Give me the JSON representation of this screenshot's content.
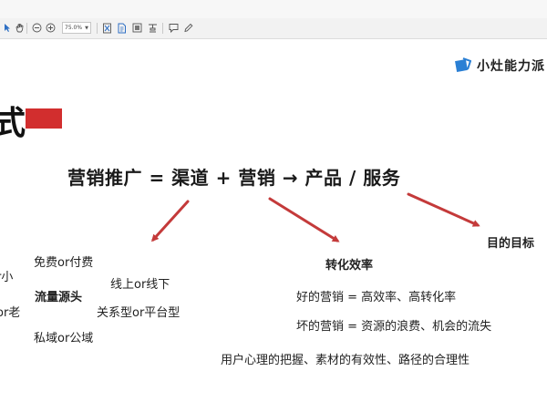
{
  "toolbar": {
    "zoom_value": "75.0%",
    "icons": [
      "pointer-icon",
      "hand-icon",
      "zoom-out-icon",
      "zoom-in-icon",
      "fit-page-icon",
      "page-icon",
      "export-icon",
      "stamp-icon",
      "comment-icon",
      "pen-icon"
    ]
  },
  "brand": {
    "text": "小灶能力派"
  },
  "heading": "式",
  "formula": "营销推广 = 渠道 + 营销 → 产品 / 服务",
  "left_branch": {
    "cut1": "r小",
    "cut2": "or老",
    "item_paid": "免费or付费",
    "item_online": "线上or线下",
    "item_source": "流量源头",
    "item_relation": "关系型or平台型",
    "item_private": "私域or公域"
  },
  "middle_branch": {
    "title": "转化效率",
    "good": "好的营销 = 高效率、高转化率",
    "bad": "坏的营销 = 资源的浪费、机会的流失",
    "footer": "用户心理的把握、素材的有效性、路径的合理性"
  },
  "right_branch": {
    "title": "目的目标"
  },
  "colors": {
    "accent_red": "#d22e2e",
    "arrow_red": "#c43a3a",
    "brand_blue": "#2a7fd4"
  }
}
